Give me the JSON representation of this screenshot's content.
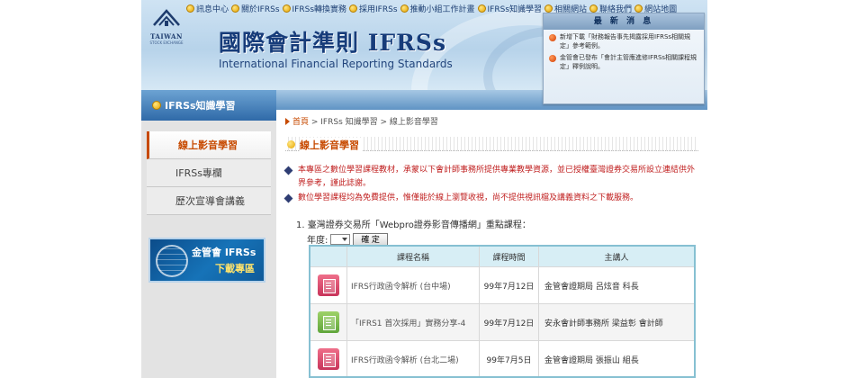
{
  "header": {
    "logo_text": "TAIWAN",
    "logo_sub": "STOCK EXCHANGE",
    "title": "國際會計準則 IFRSs",
    "subtitle": "International Financial Reporting Standards",
    "nav": [
      "訊息中心",
      "關於IFRSs",
      "IFRSs轉換實務",
      "採用IFRSs",
      "推動小組工作計畫",
      "IFRSs知識學習",
      "相關網站",
      "聯絡我們",
      "網站地圖"
    ]
  },
  "news": {
    "heading": "最 新 消 息",
    "items": [
      "新增下載「財務報告事先揭露採用IFRSs相關規定」參考範例。",
      "金管會已發布「會計主管應進修IFRSs相關課程規定」釋例說明。"
    ]
  },
  "sidebar": {
    "section_title": "IFRSs知識學習",
    "items": [
      "線上影音學習",
      "IFRSs專欄",
      "歷次宣導會講義"
    ],
    "banner_line1": "金管會 IFRSs",
    "banner_line2": "下載專區"
  },
  "main": {
    "breadcrumb_home": "首頁",
    "breadcrumb_rest": " > IFRSs 知識學習 > 線上影音學習",
    "title": "線上影音學習",
    "notice1": "本專區之數位學習課程教材，承蒙以下會計師事務所提供專業教學資源，並已授權臺灣證券交易所設立連結供外界參考，謹此誌謝。",
    "notice2": "數位學習課程均為免費提供，惟僅能於線上瀏覽收視，尚不提供視訊檔及講義資料之下載服務。",
    "course_intro": "1.  臺灣證券交易所「Webpro證券影音傳播網」重點課程：",
    "year_label": "年度:",
    "ok_button": "確 定",
    "table": {
      "headers": [
        "課程名稱",
        "課程時間",
        "主講人"
      ],
      "rows": [
        {
          "icon": "pink",
          "name": "IFRS行政函令解析 (台中場)",
          "date": "99年7月12日",
          "speaker": "金管會證期局 呂炫音 科長"
        },
        {
          "icon": "green",
          "name": "「IFRS1 首次採用」實務分享-4",
          "date": "99年7月12日",
          "speaker": "安永會計師事務所 梁益彰 會計師"
        },
        {
          "icon": "pink",
          "name": "IFRS行政函令解析 (台北二場)",
          "date": "99年7月5日",
          "speaker": "金管會證期局 張振山 組長"
        }
      ]
    }
  },
  "colors": {
    "accent_orange": "#c74a00",
    "notice_red": "#c02020",
    "header_blue": "#173c7a"
  }
}
